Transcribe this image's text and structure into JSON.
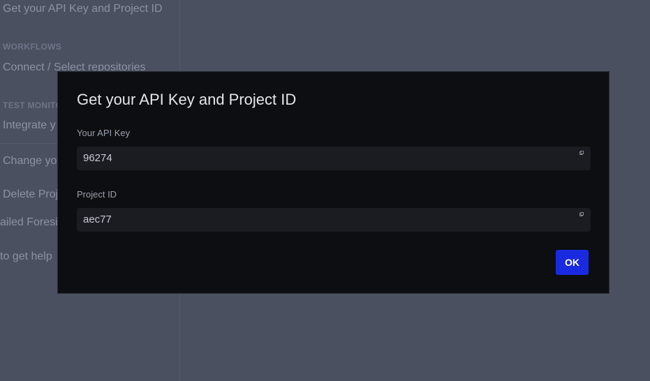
{
  "sidebar": {
    "items": [
      {
        "label": "Get your API Key and Project ID"
      },
      {
        "heading": "WORKFLOWS"
      },
      {
        "label": "Connect / Select repositories"
      },
      {
        "heading": "TEST MONITO"
      },
      {
        "label": "Integrate y"
      },
      {
        "label": "Change yo"
      },
      {
        "label": "Delete Proj"
      }
    ]
  },
  "background_text": {
    "line1": "ailed Foresig",
    "line2": "to get help"
  },
  "modal": {
    "title": "Get your API Key and Project ID",
    "api_key_label": "Your API Key",
    "api_key_value": "96274",
    "project_id_label": "Project ID",
    "project_id_value": "aec77",
    "ok_label": "OK",
    "copy_icon": "copy-icon"
  },
  "colors": {
    "overlay_bg": "#4b5061",
    "modal_bg": "#0d0e11",
    "field_bg": "#1a1c22",
    "accent": "#1a2ae0"
  }
}
